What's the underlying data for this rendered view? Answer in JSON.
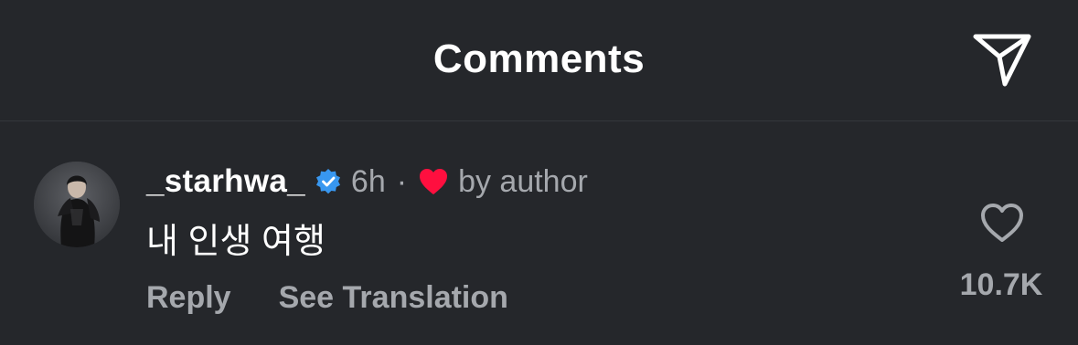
{
  "header": {
    "title": "Comments",
    "share_icon": "paper-plane-icon"
  },
  "comment": {
    "username": "_starhwa_",
    "verified_icon": "verified-badge-icon",
    "time": "6h",
    "separator": "·",
    "author_like_icon": "heart-filled-icon",
    "author_like_label": "by author",
    "text": "내 인생 여행",
    "reply_label": "Reply",
    "translate_label": "See Translation",
    "like_icon": "heart-outline-icon",
    "like_count": "10.7K"
  },
  "colors": {
    "background": "#25272b",
    "divider": "#34373c",
    "primary_text": "#ffffff",
    "secondary_text": "#a5a8ad",
    "verified_blue": "#3897f0",
    "heart_red": "#ff0f3f"
  }
}
